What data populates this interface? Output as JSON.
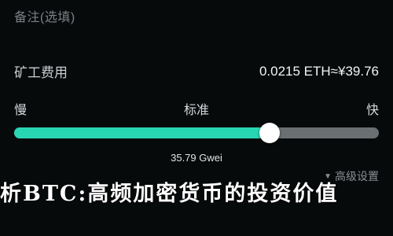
{
  "remark": {
    "placeholder": "备注(选填)"
  },
  "fee": {
    "label": "矿工费用",
    "value": "0.0215 ETH≈¥39.76"
  },
  "speed": {
    "slow": "慢",
    "standard": "标准",
    "fast": "快",
    "level_fraction": 0.7
  },
  "gas": {
    "price": "35.79 Gwei"
  },
  "advanced": {
    "label": "高级设置",
    "icon": "triangle-down-icon"
  },
  "overlay": {
    "text": "析BTC:高频加密货币的投资价值"
  },
  "colors": {
    "background": "#070a0b",
    "accent": "#29d6b3",
    "track": "#6a6f72",
    "knob": "#ffffff"
  }
}
